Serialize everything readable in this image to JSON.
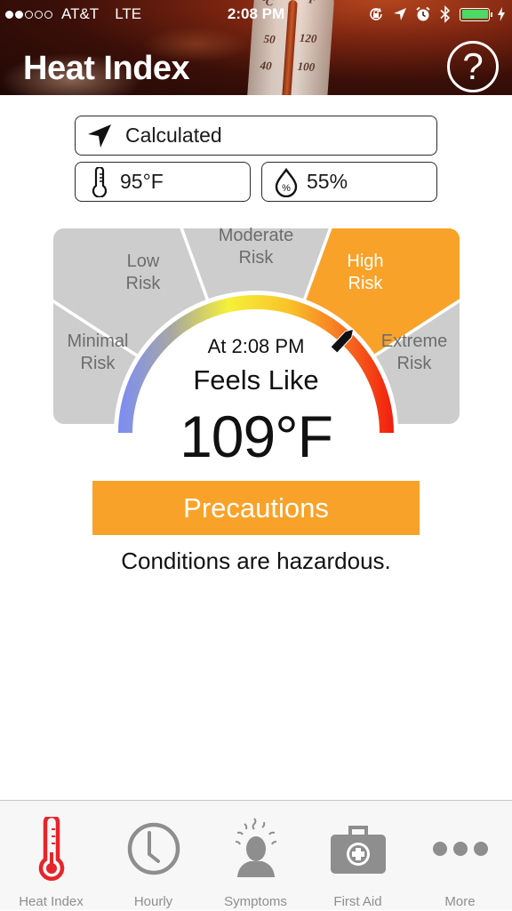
{
  "status_bar": {
    "signal_dots_filled": 2,
    "signal_dots_total": 5,
    "carrier": "AT&T",
    "network": "LTE",
    "time": "2:08 PM",
    "icons": [
      "rotation-lock-icon",
      "location-arrow-icon",
      "alarm-icon",
      "bluetooth-icon",
      "battery-icon",
      "charging-bolt-icon"
    ],
    "battery_level": 1.0,
    "battery_color": "#4cd964"
  },
  "header": {
    "title": "Heat Index",
    "help_label": "?",
    "background_thermometer_labels": [
      "°C",
      "°F",
      "50",
      "120",
      "40",
      "100"
    ]
  },
  "inputs": {
    "location": {
      "icon": "location-arrow-icon",
      "value": "Calculated"
    },
    "temperature": {
      "icon": "thermometer-icon",
      "value": "95°F"
    },
    "humidity": {
      "icon": "humidity-drop-icon",
      "icon_glyph": "%",
      "value": "55%"
    }
  },
  "gauge": {
    "segments": [
      {
        "label_line1": "Minimal",
        "label_line2": "Risk",
        "active": false
      },
      {
        "label_line1": "Low",
        "label_line2": "Risk",
        "active": false
      },
      {
        "label_line1": "Moderate",
        "label_line2": "Risk",
        "active": false
      },
      {
        "label_line1": "High",
        "label_line2": "Risk",
        "active": true
      },
      {
        "label_line1": "Extreme",
        "label_line2": "Risk",
        "active": false
      }
    ],
    "inactive_color": "#cdcdcd",
    "active_color": "#f9a22a",
    "inactive_text_color": "#6d6d6d",
    "active_text_color": "#ffffff",
    "arc_colors": [
      "#7b8cf5",
      "#a9a9a0",
      "#f5f038",
      "#f9c22a",
      "#f77a22",
      "#f21c0e"
    ],
    "needle_fraction": 0.74,
    "at_time": "At 2:08 PM",
    "feels_like_label": "Feels Like",
    "feels_like_value": "109°F"
  },
  "precautions_button": {
    "label": "Precautions",
    "color": "#f9a22a"
  },
  "condition_text": "Conditions are hazardous.",
  "tab_bar": {
    "active_color": "#e6252a",
    "inactive_color": "#8e8e8e",
    "tabs": [
      {
        "label": "Heat Index",
        "icon": "thermometer-icon",
        "active": true
      },
      {
        "label": "Hourly",
        "icon": "clock-icon",
        "active": false
      },
      {
        "label": "Symptoms",
        "icon": "headache-person-icon",
        "active": false
      },
      {
        "label": "First Aid",
        "icon": "first-aid-kit-icon",
        "active": false
      },
      {
        "label": "More",
        "icon": "more-dots-icon",
        "active": false
      }
    ]
  }
}
